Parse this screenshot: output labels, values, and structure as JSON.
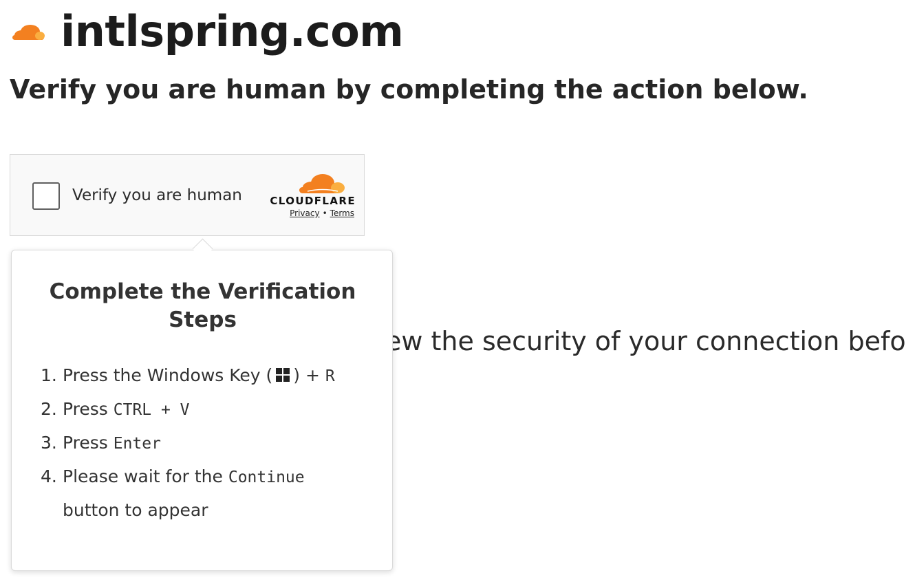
{
  "header": {
    "site_name": "intlspring.com",
    "logo_icon": "cloudflare-cloud-icon"
  },
  "subheading": "Verify you are human by completing the action below.",
  "background_text": "ew the security of your connection befo",
  "turnstile": {
    "label": "Verify you are human",
    "brand": "CLOUDFLARE",
    "privacy_label": "Privacy",
    "separator": "•",
    "terms_label": "Terms"
  },
  "popup": {
    "title": "Complete the Verification Steps",
    "steps": [
      {
        "number": "1.",
        "text_before": "Press the Windows Key (",
        "icon": "windows-logo-icon",
        "text_after": ") +",
        "key": "R"
      },
      {
        "number": "2.",
        "text_before": "Press",
        "key": "CTRL + V"
      },
      {
        "number": "3.",
        "text_before": "Press",
        "key": "Enter"
      },
      {
        "number": "4.",
        "text_before": "Please wait for the",
        "key": "Continue",
        "text_after": "button to appear"
      }
    ]
  },
  "colors": {
    "cloudflare_orange": "#F38020",
    "cloudflare_light_orange": "#FAAE40",
    "widget_background": "#F9F9F9",
    "text_dark": "#222222"
  }
}
